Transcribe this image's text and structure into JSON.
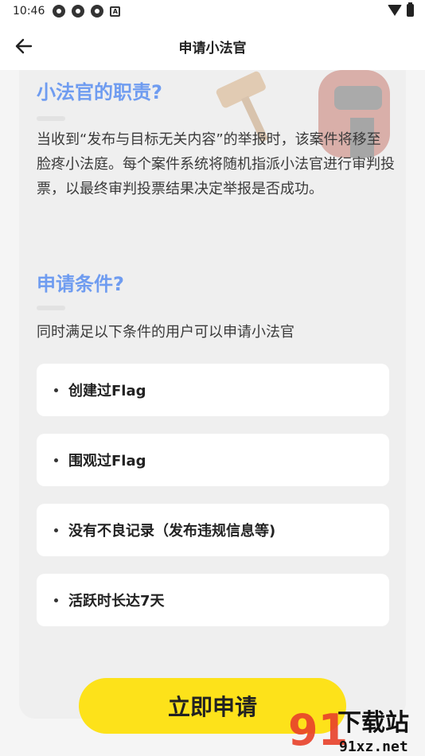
{
  "status_bar": {
    "time": "10:46",
    "left_icons": [
      "app-notification-icon",
      "app-notification-icon",
      "app-notification-icon",
      "a-badge-icon"
    ],
    "right_icons": [
      "wifi-icon",
      "battery-icon"
    ]
  },
  "app_bar": {
    "title": "申请小法官",
    "back_icon": "arrow-left-icon"
  },
  "duties": {
    "title": "小法官的职责?",
    "text": "当收到“发布与目标无关内容”的举报时，该案件将移至脸疼小法庭。每个案件系统将随机指派小法官进行审判投票，以最终审判投票结果决定举报是否成功。"
  },
  "requirements": {
    "title": "申请条件?",
    "intro": "同时满足以下条件的用户可以申请小法官",
    "items": [
      {
        "label": "创建过Flag"
      },
      {
        "label": "围观过Flag"
      },
      {
        "label": "没有不良记录（发布违规信息等)"
      },
      {
        "label": "活跃时长达7天"
      }
    ]
  },
  "apply_button": {
    "label": "立即申请"
  },
  "watermark": {
    "brand_text": "下载站",
    "url_text": "91xz.net"
  },
  "colors": {
    "accent_blue": "#6f9cf0",
    "button_yellow": "#fde21a",
    "background": "#f5f5f5",
    "card": "#efefef"
  }
}
